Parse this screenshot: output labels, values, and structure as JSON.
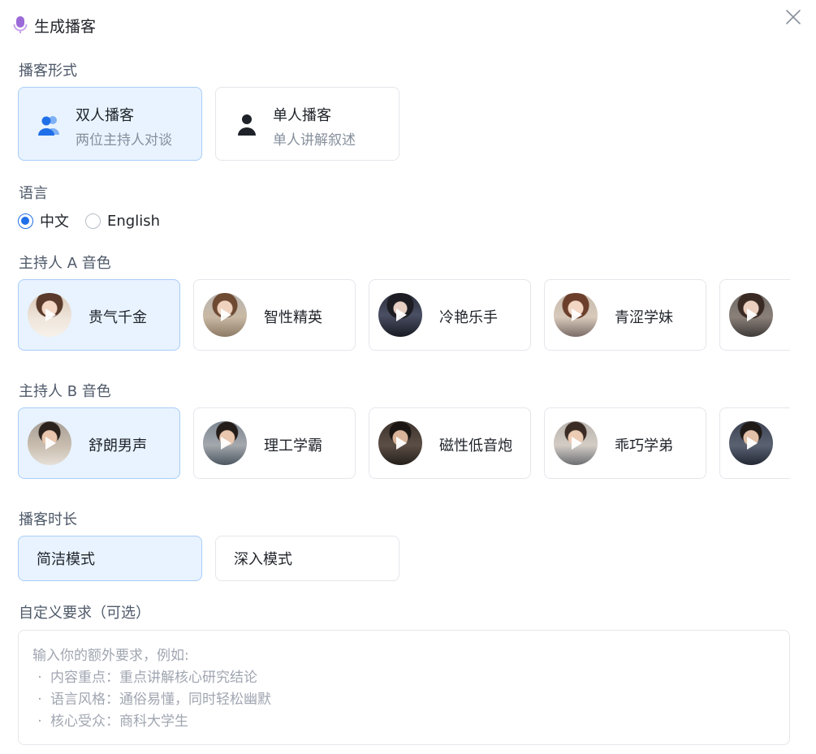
{
  "header": {
    "title": "生成播客",
    "icon": "microphone-icon",
    "close_icon": "close-icon"
  },
  "format": {
    "label": "播客形式",
    "options": [
      {
        "title": "双人播客",
        "desc": "两位主持人对谈",
        "icon": "two-people-icon",
        "selected": true
      },
      {
        "title": "单人播客",
        "desc": "单人讲解叙述",
        "icon": "person-icon",
        "selected": false
      }
    ]
  },
  "language": {
    "label": "语言",
    "options": [
      {
        "label": "中文",
        "selected": true
      },
      {
        "label": "English",
        "selected": false
      }
    ]
  },
  "host_a": {
    "label": "主持人 A 音色",
    "voices": [
      {
        "name": "贵气千金",
        "selected": true
      },
      {
        "name": "智性精英",
        "selected": false
      },
      {
        "name": "冷艳乐手",
        "selected": false
      },
      {
        "name": "青涩学妹",
        "selected": false
      },
      {
        "name": "",
        "selected": false
      }
    ]
  },
  "host_b": {
    "label": "主持人 B 音色",
    "voices": [
      {
        "name": "舒朗男声",
        "selected": true
      },
      {
        "name": "理工学霸",
        "selected": false
      },
      {
        "name": "磁性低音炮",
        "selected": false
      },
      {
        "name": "乖巧学弟",
        "selected": false
      },
      {
        "name": "",
        "selected": false
      }
    ]
  },
  "duration": {
    "label": "播客时长",
    "options": [
      {
        "label": "简洁模式",
        "selected": true
      },
      {
        "label": "深入模式",
        "selected": false
      }
    ]
  },
  "custom": {
    "label": "自定义要求（可选）",
    "placeholder_intro": "输入你的额外要求，例如:",
    "placeholder_items": [
      "内容重点：重点讲解核心研究结论",
      "语言风格：通俗易懂，同时轻松幽默",
      "核心受众：商科大学生"
    ],
    "bullet": "·"
  },
  "colors": {
    "accent": "#1f6fe8",
    "selected_bg": "#e8f3ff",
    "selected_border": "#a9cdf7",
    "mic": "#9b6ad8"
  }
}
